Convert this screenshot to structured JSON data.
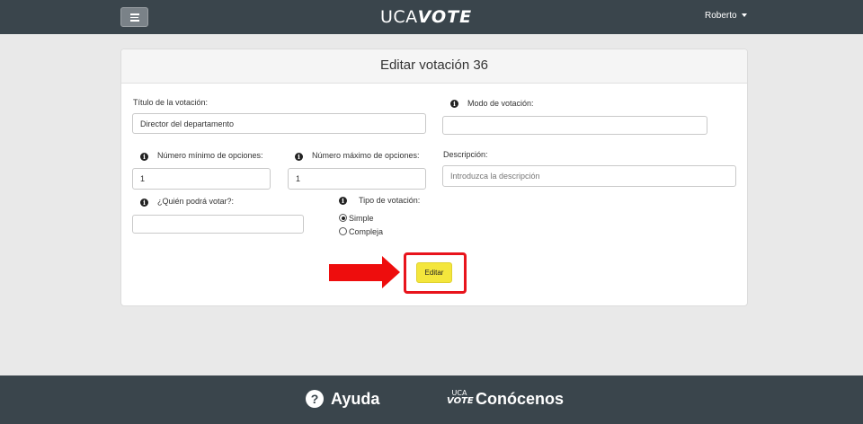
{
  "header": {
    "brand_part1": "UCA",
    "brand_part2": "VOTE",
    "user_name": "Roberto"
  },
  "form": {
    "title": "Editar votación 36",
    "title_label": "Título de la votación:",
    "title_value": "Director del departamento",
    "mode_label": "Modo de votación:",
    "mode_value": "",
    "min_options_label": "Número mínimo de opciones:",
    "min_options_value": "1",
    "max_options_label": "Número máximo de opciones:",
    "max_options_value": "1",
    "description_label": "Descripción:",
    "description_placeholder": "Introduzca la descripción",
    "who_can_vote_label": "¿Quién podrá votar?:",
    "who_can_vote_value": "",
    "vote_type_label": "Tipo de votación:",
    "vote_type_options": [
      "Simple",
      "Compleja"
    ],
    "vote_type_selected": "Simple",
    "submit_label": "Editar"
  },
  "annotation": {
    "highlight_color": "#e8141c",
    "arrow_color": "#ee0d0d"
  },
  "footer": {
    "help_label": "Ayuda",
    "about_logo_top": "UCA",
    "about_logo_bottom": "VOTE",
    "about_label": "Conócenos"
  },
  "colors": {
    "bar_bg": "#3a454c",
    "page_bg": "#e9e9e9",
    "button_accent": "#f4e63c"
  }
}
